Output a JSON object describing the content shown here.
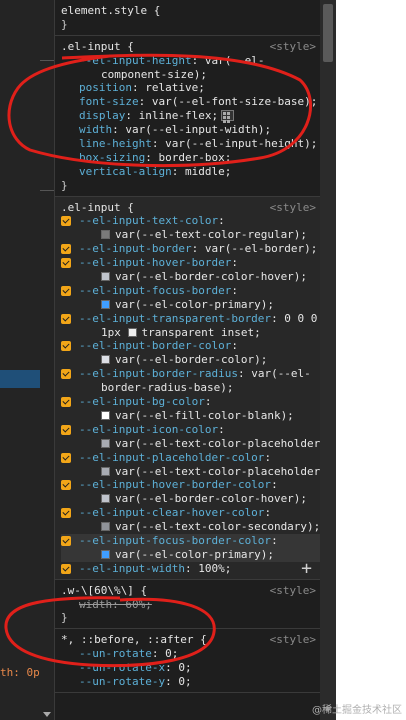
{
  "left_panel": {
    "fragment_text": "th: 0p"
  },
  "rules": [
    {
      "selector": "element.style {",
      "origin": "",
      "lines": [
        {
          "kind": "close",
          "text": "}"
        }
      ]
    },
    {
      "selector": ".el-input {",
      "origin": "<style>",
      "lines": [
        {
          "kind": "decl",
          "prop": "--el-input-height",
          "val": ": var(--el-"
        },
        {
          "kind": "cont",
          "val": "component-size);"
        },
        {
          "kind": "decl",
          "prop": "position",
          "val": ": relative;"
        },
        {
          "kind": "decl",
          "prop": "font-size",
          "val": ": var(--el-font-size-base);"
        },
        {
          "kind": "decl",
          "prop": "display",
          "val": ": inline-flex;",
          "icon": "flexbox-editor-icon"
        },
        {
          "kind": "decl",
          "prop": "width",
          "val": ": var(--el-input-width);"
        },
        {
          "kind": "decl",
          "prop": "line-height",
          "val": ": var(--el-input-height);"
        },
        {
          "kind": "decl",
          "prop": "box-sizing",
          "val": ": border-box;"
        },
        {
          "kind": "decl",
          "prop": "vertical-align",
          "val": ": middle;"
        },
        {
          "kind": "close",
          "text": "}"
        }
      ]
    },
    {
      "selector": ".el-input {",
      "origin": "<style>",
      "lines": [
        {
          "kind": "cb",
          "prop": "--el-input-text-color",
          "val": ":"
        },
        {
          "kind": "cont",
          "swatch": "#7a7a7a",
          "val": "var(--el-text-color-regular);"
        },
        {
          "kind": "cb",
          "prop": "--el-input-border",
          "val": ": var(--el-border);"
        },
        {
          "kind": "cb",
          "prop": "--el-input-hover-border",
          "val": ":"
        },
        {
          "kind": "cont",
          "swatch": "#c0c4cc",
          "val": "var(--el-border-color-hover);"
        },
        {
          "kind": "cb",
          "prop": "--el-input-focus-border",
          "val": ":"
        },
        {
          "kind": "cont",
          "swatch": "#409eff",
          "val": "var(--el-color-primary);"
        },
        {
          "kind": "cb",
          "prop": "--el-input-transparent-border",
          "val": ": 0 0 0"
        },
        {
          "kind": "cont",
          "val": "1px ",
          "swatch2": "#eeeeee",
          "val2": "transparent inset;"
        },
        {
          "kind": "cb",
          "prop": "--el-input-border-color",
          "val": ":"
        },
        {
          "kind": "cont",
          "swatch": "#dcdfe6",
          "val": "var(--el-border-color);"
        },
        {
          "kind": "cb",
          "prop": "--el-input-border-radius",
          "val": ": var(--el-"
        },
        {
          "kind": "cont",
          "val": "border-radius-base);"
        },
        {
          "kind": "cb",
          "prop": "--el-input-bg-color",
          "val": ":"
        },
        {
          "kind": "cont",
          "swatch": "#ffffff",
          "val": "var(--el-fill-color-blank);"
        },
        {
          "kind": "cb",
          "prop": "--el-input-icon-color",
          "val": ":"
        },
        {
          "kind": "cont",
          "swatch": "#a8abb2",
          "val": "var(--el-text-color-placeholder"
        },
        {
          "kind": "cb",
          "prop": "--el-input-placeholder-color",
          "val": ":"
        },
        {
          "kind": "cont",
          "swatch": "#a8abb2",
          "val": "var(--el-text-color-placeholder"
        },
        {
          "kind": "cb",
          "prop": "--el-input-hover-border-color",
          "val": ":"
        },
        {
          "kind": "cont",
          "swatch": "#c0c4cc",
          "val": "var(--el-border-color-hover);"
        },
        {
          "kind": "cb",
          "prop": "--el-input-clear-hover-color",
          "val": ":"
        },
        {
          "kind": "cont",
          "swatch": "#909399",
          "val": "var(--el-text-color-secondary);"
        },
        {
          "kind": "cb",
          "prop": "--el-input-focus-border-color",
          "val": ":",
          "highlight": true
        },
        {
          "kind": "cont",
          "swatch": "#409eff",
          "val": "var(--el-color-primary);",
          "highlight": true
        },
        {
          "kind": "cb",
          "prop": "--el-input-width",
          "val": ": 100%;",
          "plus": "+"
        }
      ]
    },
    {
      "selector": ".w-\\[60\\%\\] {",
      "origin": "<style>",
      "lines": [
        {
          "kind": "decl",
          "prop": "width",
          "val": ": 60%;",
          "struck": true
        },
        {
          "kind": "close",
          "text": "}"
        }
      ]
    },
    {
      "selector": "*, ::before, ::after {",
      "origin": "<style>",
      "lines": [
        {
          "kind": "decl",
          "prop": "--un-rotate",
          "val": ": 0;"
        },
        {
          "kind": "decl",
          "prop": "--un-rotate-x",
          "val": ": 0;"
        },
        {
          "kind": "decl",
          "prop": "--un-rotate-y",
          "val": ": 0;"
        }
      ]
    }
  ],
  "watermark": "@稀土掘金技术社区",
  "annotation_color": "#e0201a"
}
